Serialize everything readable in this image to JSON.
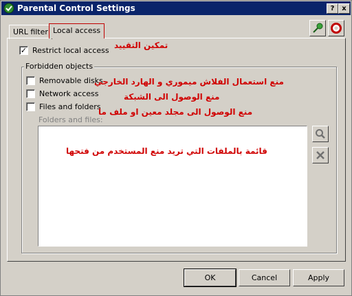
{
  "window": {
    "title": "Parental Control Settings"
  },
  "title_buttons": {
    "help": "?",
    "close": "x"
  },
  "tabs": [
    {
      "label": "URL filter"
    },
    {
      "label": "Local access"
    }
  ],
  "restrict": {
    "label": "Restrict local access",
    "checked": true
  },
  "group": {
    "label": "Forbidden objects"
  },
  "options": [
    {
      "label": "Removable disks",
      "checked": false
    },
    {
      "label": "Network access",
      "checked": false
    },
    {
      "label": "Files and folders",
      "checked": false
    }
  ],
  "folders_label": "Folders and files:",
  "buttons": {
    "ok": "OK",
    "cancel": "Cancel",
    "apply": "Apply"
  },
  "annotations": {
    "restrict": "تمكين التقييد",
    "removable": "منع استعمال الفلاش ميموري و الهارد الخارجي",
    "network": "منع الوصول الى الشبكة",
    "files": "منع الوصول الى مجلد معين او ملف ما",
    "list": "قائمة بالملفات التي تريد منع المستخدم من فتحها"
  },
  "accent": "#d00000"
}
